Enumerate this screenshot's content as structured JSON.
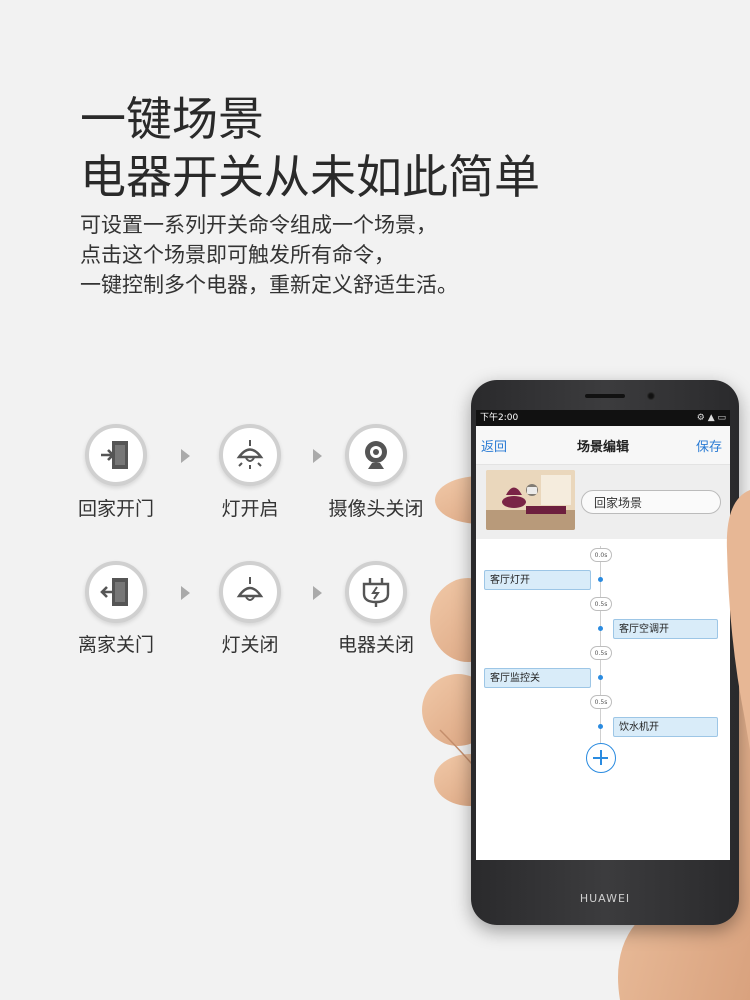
{
  "headline": {
    "line1": "一键场景",
    "line2": "电器开关从未如此简单"
  },
  "description": {
    "line1": "可设置一系列开关命令组成一个场景，",
    "line2": "点击这个场景即可触发所有命令，",
    "line3": "一键控制多个电器，重新定义舒适生活。"
  },
  "scenes": {
    "row1": [
      {
        "label": "回家开门",
        "icon": "door-enter-icon"
      },
      {
        "label": "灯开启",
        "icon": "lamp-on-icon"
      },
      {
        "label": "摄像头关闭",
        "icon": "webcam-icon"
      }
    ],
    "row2": [
      {
        "label": "离家关门",
        "icon": "door-exit-icon"
      },
      {
        "label": "灯关闭",
        "icon": "lamp-off-icon"
      },
      {
        "label": "电器关闭",
        "icon": "plug-icon"
      }
    ]
  },
  "phone": {
    "brand": "HUAWEI",
    "status_time": "下午2:00",
    "nav": {
      "back": "返回",
      "title": "场景编辑",
      "save": "保存"
    },
    "scene_name": "回家场景",
    "timeline": {
      "delays": [
        "0.0s",
        "0.5s",
        "0.5s",
        "0.5s"
      ],
      "tasks": [
        "客厅灯开",
        "客厅空调开",
        "客厅监控关",
        "饮水机开"
      ]
    }
  },
  "colors": {
    "accent": "#2a8be0",
    "task_bg": "#d9ecf9"
  }
}
